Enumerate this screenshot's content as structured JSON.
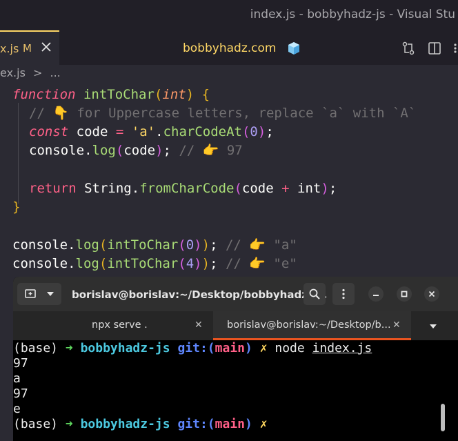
{
  "window": {
    "title": "index.js - bobbyhadz-js - Visual Stu"
  },
  "editor_tab": {
    "filename": "x.js",
    "modified": "M",
    "close_icon": "close-icon"
  },
  "header": {
    "center_title": "bobbyhadz.com",
    "cube_icon": "ice-cube-icon",
    "actions": [
      "compare-changes-icon",
      "split-editor-icon",
      "more-icon"
    ]
  },
  "breadcrumb": {
    "file": "ex.js",
    "separator": ">",
    "ellipsis": "..."
  },
  "code": {
    "lines": [
      "function intToChar(int) {",
      "  // 👇 for Uppercase letters, replace `a` with `A`",
      "  const code = 'a'.charCodeAt(0);",
      "  console.log(code); // 👉 97",
      "",
      "  return String.fromCharCode(code + int);",
      "}",
      "",
      "console.log(intToChar(0)); // 👉 \"a\"",
      "console.log(intToChar(4)); // 👉 \"e\""
    ],
    "tokens": {
      "l1": {
        "kw": "function",
        "name": "intToChar",
        "open": "(",
        "param": "int",
        "close": ")",
        "brace": "{"
      },
      "l2": {
        "comment": "// 👇 for Uppercase letters, replace `a` with `A`"
      },
      "l3": {
        "kw": "const",
        "var": "code",
        "eq": "=",
        "str": "'a'",
        "dot": ".",
        "method": "charCodeAt",
        "open": "(",
        "num": "0",
        "close": ")",
        "semi": ";"
      },
      "l4": {
        "obj": "console",
        "dot": ".",
        "method": "log",
        "open": "(",
        "arg": "code",
        "close": ")",
        "semi": ";",
        "comment": "// 👉 97"
      },
      "l6": {
        "kw": "return",
        "cls": "String",
        "dot": ".",
        "method": "fromCharCode",
        "open": "(",
        "a": "code",
        "op": "+",
        "b": "int",
        "close": ")",
        "semi": ";"
      },
      "l7": {
        "brace": "}"
      },
      "l9": {
        "obj": "console",
        "dot": ".",
        "method": "log",
        "open": "(",
        "fn": "intToChar",
        "open2": "(",
        "num": "0",
        "close2": ")",
        "close": ")",
        "semi": ";",
        "comment": "// 👉 \"a\""
      },
      "l10": {
        "obj": "console",
        "dot": ".",
        "method": "log",
        "open": "(",
        "fn": "intToChar",
        "open2": "(",
        "num": "4",
        "close2": ")",
        "close": ")",
        "semi": ";",
        "comment": "// 👉 \"e\""
      }
    }
  },
  "terminal": {
    "title": "borislav@borislav:~/Desktop/bobbyhadz-r...",
    "buttons": [
      "new-tab-icon",
      "dropdown-icon",
      "search-icon",
      "menu-icon",
      "minimize-icon",
      "maximize-icon",
      "close-icon"
    ],
    "tabs": [
      {
        "label": "npx serve .",
        "active": false
      },
      {
        "label": "borislav@borislav:~/Desktop/b...",
        "active": true
      }
    ],
    "lines": [
      {
        "base": "(base)",
        "arrow": "➜",
        "dir": "bobbyhadz-js",
        "git": "git:(",
        "branch": "main",
        "git_close": ")",
        "x": "✗",
        "cmd": "node",
        "arg": "index.js"
      },
      {
        "text": "97"
      },
      {
        "text": "a"
      },
      {
        "text": "97"
      },
      {
        "text": "e"
      },
      {
        "base": "(base)",
        "arrow": "➜",
        "dir": "bobbyhadz-js",
        "git": "git:(",
        "branch": "main",
        "git_close": ")",
        "x": "✗"
      }
    ]
  }
}
